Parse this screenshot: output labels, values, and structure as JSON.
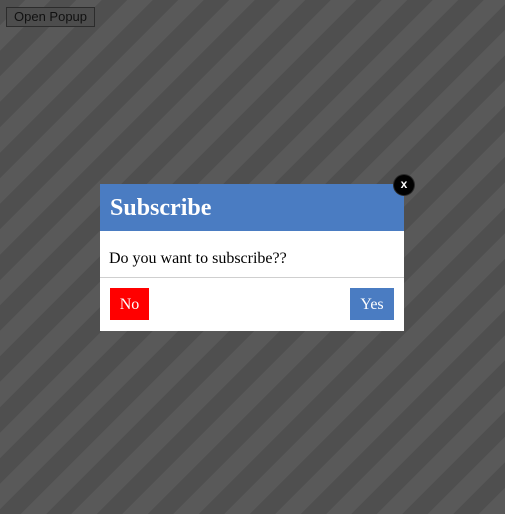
{
  "toolbar": {
    "open_popup_label": "Open Popup"
  },
  "popup": {
    "title": "Subscribe",
    "message": "Do you want to subscribe??",
    "no_label": "No",
    "yes_label": "Yes",
    "close_label": "x"
  },
  "colors": {
    "header_blue": "#4a7cc2",
    "no_red": "#ff0000",
    "overlay_dark": "#555555"
  }
}
